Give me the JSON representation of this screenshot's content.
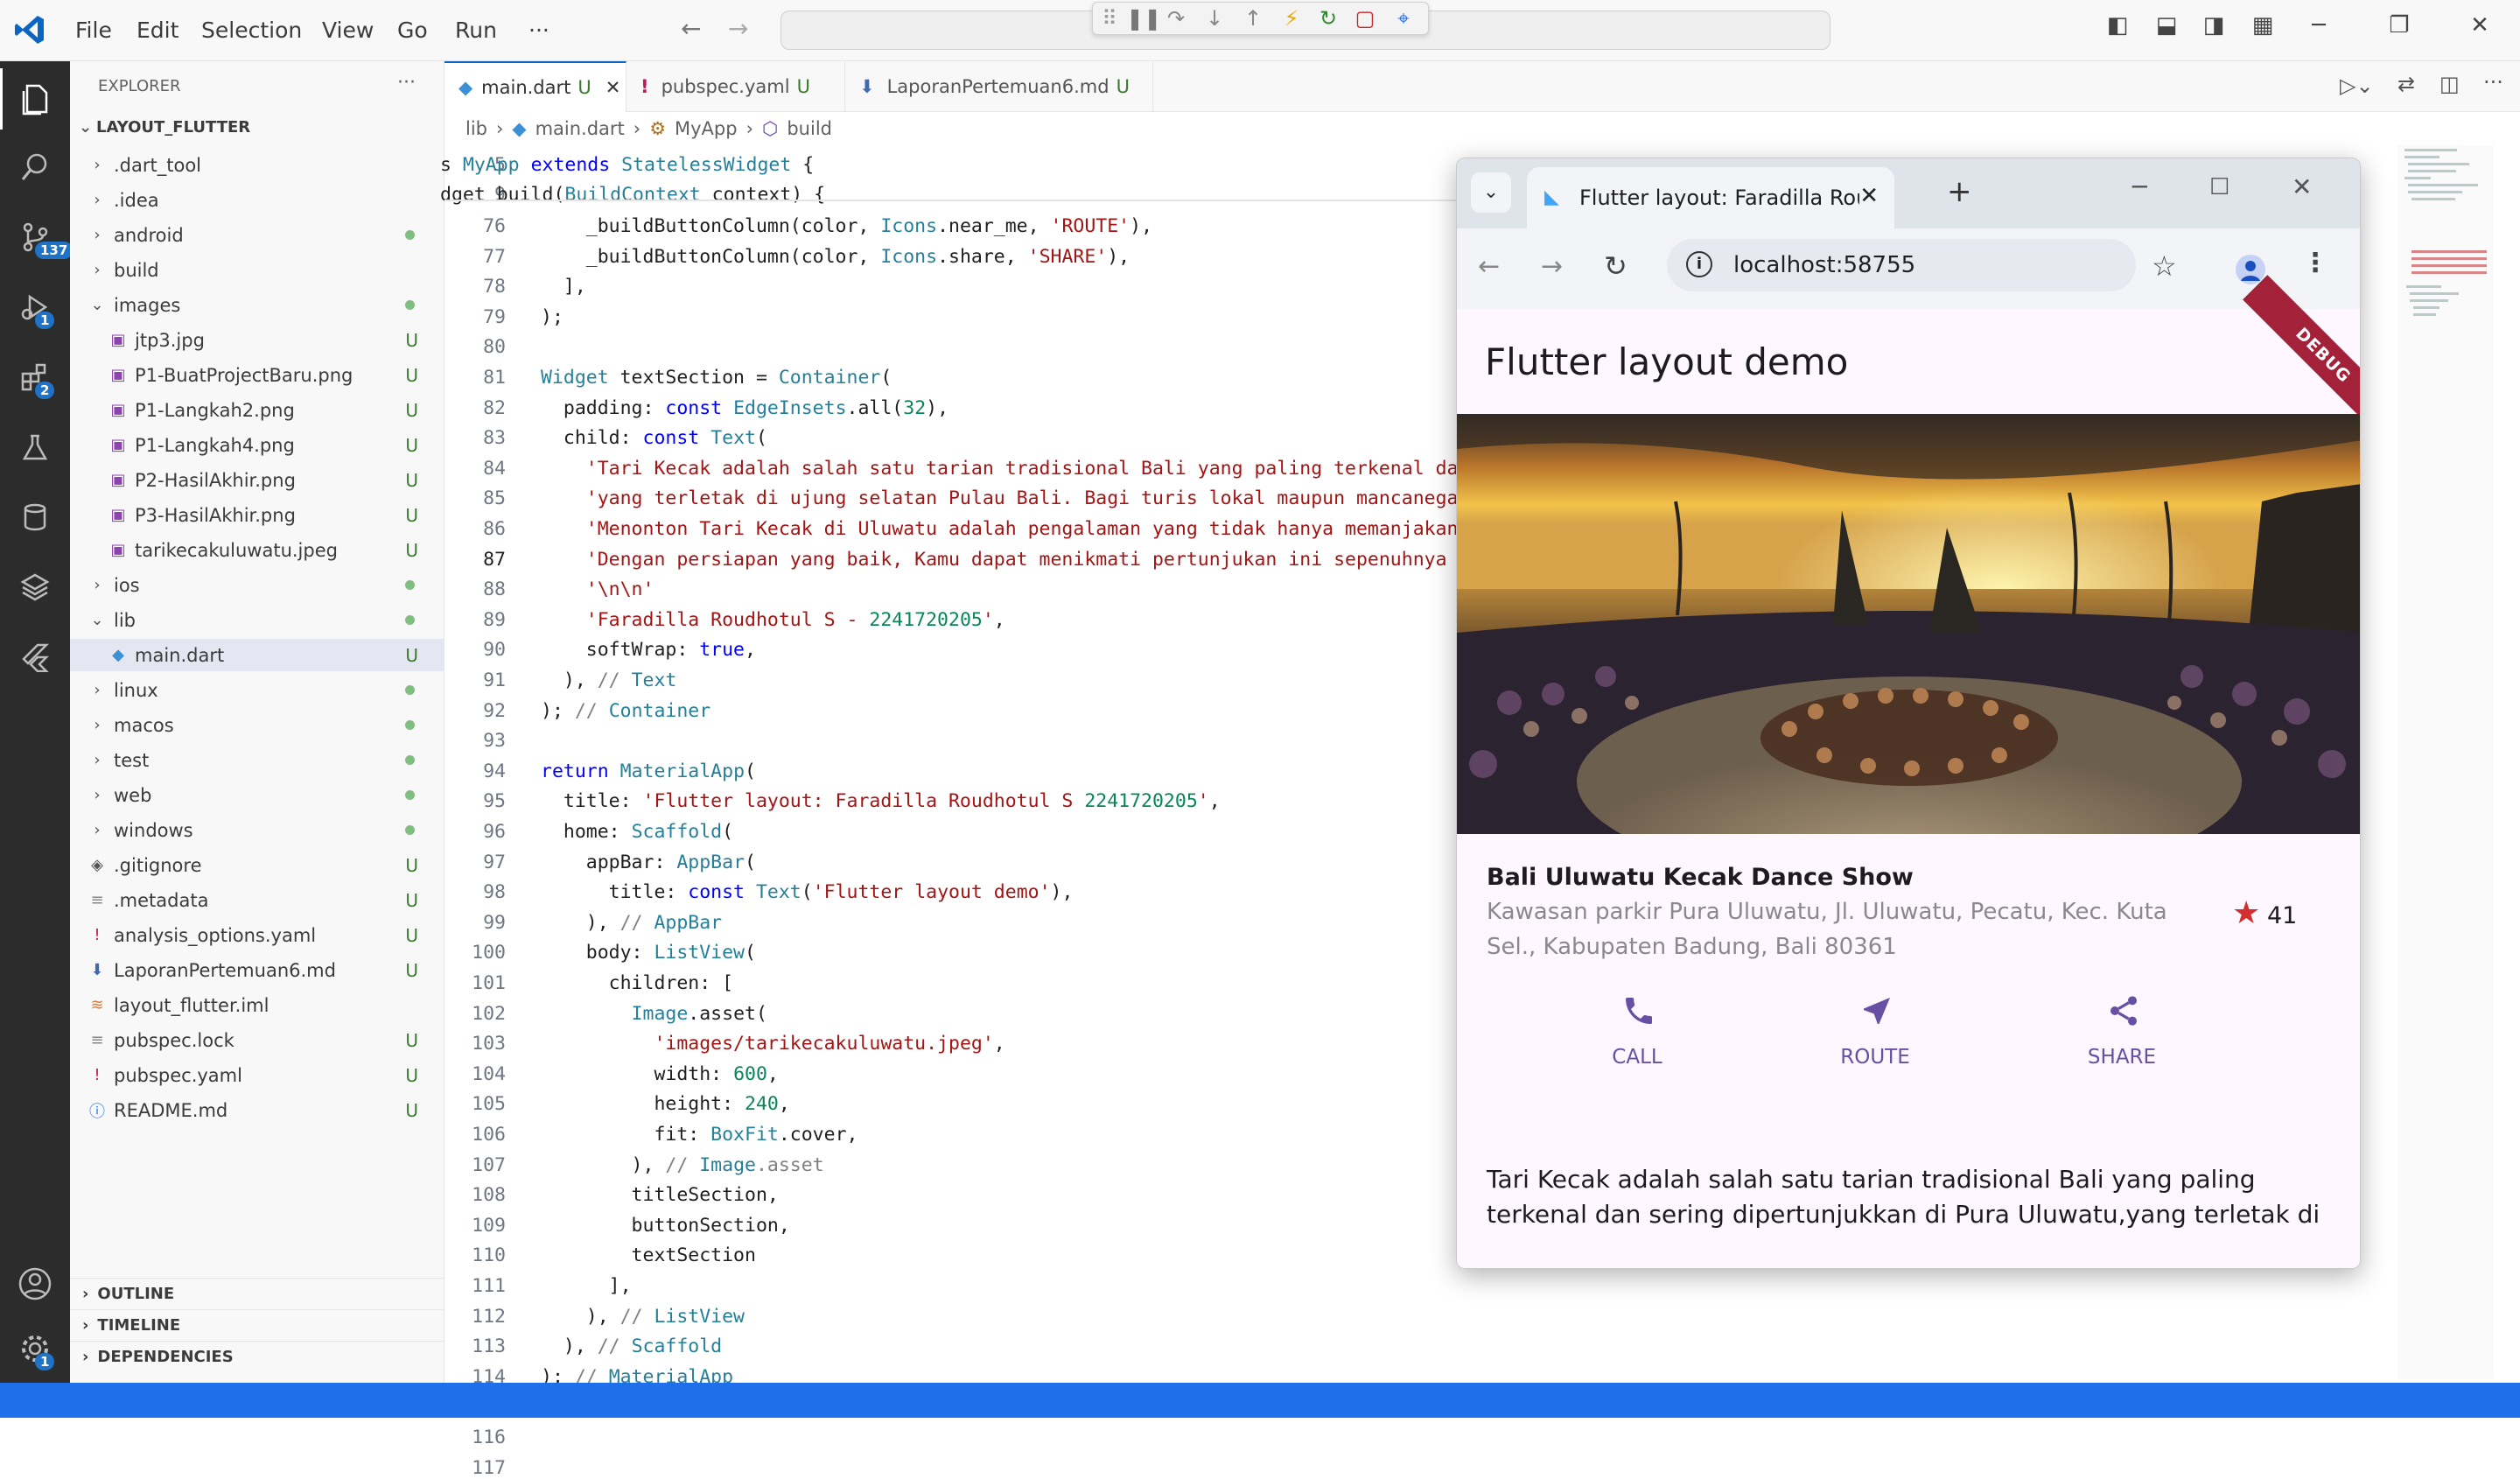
{
  "titlebar": {
    "menu": [
      "File",
      "Edit",
      "Selection",
      "View",
      "Go",
      "Run",
      "···"
    ]
  },
  "activity": {
    "scm_badge": "137",
    "debug_badge": "1",
    "extensions_badge": "2",
    "settings_badge": "1"
  },
  "sidebar": {
    "title": "EXPLORER",
    "more": "···",
    "root": "LAYOUT_FLUTTER",
    "items": [
      {
        "label": ".dart_tool",
        "type": "folder",
        "status": ""
      },
      {
        "label": ".idea",
        "type": "folder",
        "status": ""
      },
      {
        "label": "android",
        "type": "folder",
        "status": "dot"
      },
      {
        "label": "build",
        "type": "folder",
        "status": ""
      },
      {
        "label": "images",
        "type": "folder-open",
        "status": "dot"
      },
      {
        "label": "jtp3.jpg",
        "type": "image",
        "status": "U"
      },
      {
        "label": "P1-BuatProjectBaru.png",
        "type": "image",
        "status": "U"
      },
      {
        "label": "P1-Langkah2.png",
        "type": "image",
        "status": "U"
      },
      {
        "label": "P1-Langkah4.png",
        "type": "image",
        "status": "U"
      },
      {
        "label": "P2-HasilAkhir.png",
        "type": "image",
        "status": "U"
      },
      {
        "label": "P3-HasilAkhir.png",
        "type": "image",
        "status": "U"
      },
      {
        "label": "tarikecakuluwatu.jpeg",
        "type": "image",
        "status": "U"
      },
      {
        "label": "ios",
        "type": "folder",
        "status": "dot"
      },
      {
        "label": "lib",
        "type": "folder-open",
        "status": "dot"
      },
      {
        "label": "main.dart",
        "type": "dart",
        "status": "U"
      },
      {
        "label": "linux",
        "type": "folder",
        "status": "dot"
      },
      {
        "label": "macos",
        "type": "folder",
        "status": "dot"
      },
      {
        "label": "test",
        "type": "folder",
        "status": "dot"
      },
      {
        "label": "web",
        "type": "folder",
        "status": "dot"
      },
      {
        "label": "windows",
        "type": "folder",
        "status": "dot"
      },
      {
        "label": ".gitignore",
        "type": "git",
        "status": "U"
      },
      {
        "label": ".metadata",
        "type": "file",
        "status": "U"
      },
      {
        "label": "analysis_options.yaml",
        "type": "yaml",
        "status": "U"
      },
      {
        "label": "LaporanPertemuan6.md",
        "type": "md",
        "status": "U"
      },
      {
        "label": "layout_flutter.iml",
        "type": "iml",
        "status": ""
      },
      {
        "label": "pubspec.lock",
        "type": "file",
        "status": "U"
      },
      {
        "label": "pubspec.yaml",
        "type": "yaml",
        "status": "U"
      },
      {
        "label": "README.md",
        "type": "info",
        "status": "U"
      }
    ],
    "sections": [
      "OUTLINE",
      "TIMELINE",
      "DEPENDENCIES"
    ]
  },
  "tabs": [
    {
      "label": "main.dart",
      "status": "U",
      "active": true
    },
    {
      "label": "pubspec.yaml",
      "status": "U",
      "active": false
    },
    {
      "label": "LaporanPertemuan6.md",
      "status": "U",
      "active": false
    }
  ],
  "breadcrumb": [
    "lib",
    "main.dart",
    "MyApp",
    "build"
  ],
  "code": {
    "sticky": [
      {
        "ln": "5",
        "text": "s MyApp extends StatelessWidget {"
      },
      {
        "ln": "9",
        "text": "dget build(BuildContext context) {"
      }
    ],
    "lines": [
      {
        "ln": "76",
        "text": "    _buildButtonColumn(color, Icons.near_me, 'ROUTE'),"
      },
      {
        "ln": "77",
        "text": "    _buildButtonColumn(color, Icons.share, 'SHARE'),"
      },
      {
        "ln": "78",
        "text": "  ],"
      },
      {
        "ln": "79",
        "text": ");"
      },
      {
        "ln": "80",
        "text": ""
      },
      {
        "ln": "81",
        "text": "Widget textSection = Container("
      },
      {
        "ln": "82",
        "text": "  padding: const EdgeInsets.all(32),"
      },
      {
        "ln": "83",
        "text": "  child: const Text("
      },
      {
        "ln": "84",
        "text": "    'Tari Kecak adalah salah satu tarian tradisional Bali yang paling terkenal dan sering dipertunjukkan di Pura Uluwatu,'"
      },
      {
        "ln": "85",
        "text": "    'yang terletak di ujung selatan Pulau Bali. Bagi turis lokal maupun mancanegara, pertunjukan ini menjadi daya tarik tersendiri.'"
      },
      {
        "ln": "86",
        "text": "    'Menonton Tari Kecak di Uluwatu adalah pengalaman yang tidak hanya memanjakan mata, tetapi juga memberikan wawasan budaya yang mendalam tentang'"
      },
      {
        "ln": "87",
        "text": "    'Dengan persiapan yang baik, Kamu dapat menikmati pertunjukan ini sepenuhnya dan pulang dengan kenangan yang tak terlupakan.'"
      },
      {
        "ln": "88",
        "text": "    '\\n\\n'"
      },
      {
        "ln": "89",
        "text": "    'Faradilla Roudhotul S - 2241720205',"
      },
      {
        "ln": "90",
        "text": "    softWrap: true,"
      },
      {
        "ln": "91",
        "text": "  ), // Text"
      },
      {
        "ln": "92",
        "text": "); // Container"
      },
      {
        "ln": "93",
        "text": ""
      },
      {
        "ln": "94",
        "text": "return MaterialApp("
      },
      {
        "ln": "95",
        "text": "  title: 'Flutter layout: Faradilla Roudhotul S 2241720205',"
      },
      {
        "ln": "96",
        "text": "  home: Scaffold("
      },
      {
        "ln": "97",
        "text": "    appBar: AppBar("
      },
      {
        "ln": "98",
        "text": "      title: const Text('Flutter layout demo'),"
      },
      {
        "ln": "99",
        "text": "    ), // AppBar"
      },
      {
        "ln": "100",
        "text": "    body: ListView("
      },
      {
        "ln": "101",
        "text": "      children: ["
      },
      {
        "ln": "102",
        "text": "        Image.asset("
      },
      {
        "ln": "103",
        "text": "          'images/tarikecakuluwatu.jpeg',"
      },
      {
        "ln": "104",
        "text": "          width: 600,"
      },
      {
        "ln": "105",
        "text": "          height: 240,"
      },
      {
        "ln": "106",
        "text": "          fit: BoxFit.cover,"
      },
      {
        "ln": "107",
        "text": "        ), // Image.asset"
      },
      {
        "ln": "108",
        "text": "        titleSection,"
      },
      {
        "ln": "109",
        "text": "        buttonSection,"
      },
      {
        "ln": "110",
        "text": "        textSection"
      },
      {
        "ln": "111",
        "text": "      ],"
      },
      {
        "ln": "112",
        "text": "    ), // ListView"
      },
      {
        "ln": "113",
        "text": "  ), // Scaffold"
      },
      {
        "ln": "114",
        "text": "); // MaterialApp"
      },
      {
        "ln": "115",
        "text": ""
      },
      {
        "ln": "116",
        "text": ""
      },
      {
        "ln": "117",
        "text": ""
      }
    ]
  },
  "browser": {
    "tab_title": "Flutter layout: Faradilla Roudhot",
    "url": "localhost:58755",
    "app": {
      "title": "Flutter layout demo",
      "debug_banner": "DEBUG",
      "place_title": "Bali Uluwatu Kecak Dance Show",
      "place_subtitle_1": "Kawasan parkir Pura Uluwatu, Jl. Uluwatu, Pecatu, Kec. Kuta",
      "place_subtitle_2": "Sel., Kabupaten Badung, Bali 80361",
      "rating": "41",
      "buttons": [
        "CALL",
        "ROUTE",
        "SHARE"
      ],
      "body_1": "Tari Kecak adalah salah satu tarian tradisional Bali yang paling",
      "body_2": "terkenal dan sering dipertunjukkan di Pura Uluwatu,yang terletak di"
    },
    "accent": "#6750a4",
    "star_color": "#d32f2f"
  }
}
